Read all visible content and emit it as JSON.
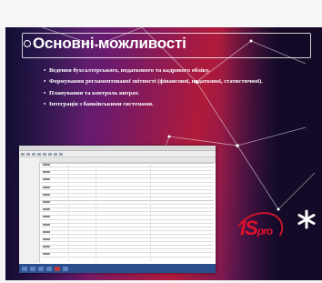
{
  "slide": {
    "title": "Основні можливості",
    "bullets": [
      "Ведення бухгалтерського, податкового та кадрового обліку.",
      "Формування регламентованої звітності (фінансової, податкової, статистичної).",
      "Планування та контроль витрат.",
      "Інтеграція з банківськими системами."
    ]
  },
  "logo": {
    "text": "IS",
    "suffix": "pro",
    "brand_color": "#e0102a"
  },
  "icons": [
    "asterisk-icon",
    "title-bullet-icon"
  ]
}
